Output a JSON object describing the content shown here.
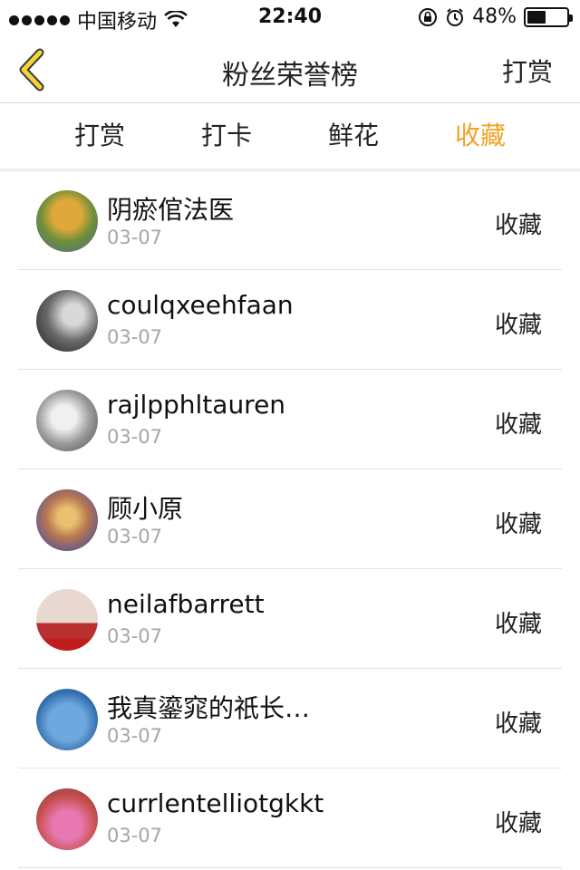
{
  "status_bar": {
    "carrier": "中国移动",
    "time": "22:40",
    "battery": "48%",
    "battery_level": 0.48,
    "icons": [
      "signal-dots-icon",
      "wifi-icon",
      "rotation-lock-icon",
      "alarm-icon",
      "battery-icon"
    ]
  },
  "nav": {
    "title": "粉丝荣誉榜",
    "action": "打赏",
    "back_icon": "chevron-left-icon",
    "accent_color": "#f0a224"
  },
  "tabs": [
    {
      "label": "打赏",
      "active": false
    },
    {
      "label": "打卡",
      "active": false
    },
    {
      "label": "鲜花",
      "active": false
    },
    {
      "label": "收藏",
      "active": true
    }
  ],
  "list": [
    {
      "name": "阴瘀倌法医",
      "date": "03-07",
      "tag": "收藏"
    },
    {
      "name": "coulqxeehfaan",
      "date": "03-07",
      "tag": "收藏"
    },
    {
      "name": "rajlpphltauren",
      "date": "03-07",
      "tag": "收藏"
    },
    {
      "name": "顾小原",
      "date": "03-07",
      "tag": "收藏"
    },
    {
      "name": "neilafbarrett",
      "date": "03-07",
      "tag": "收藏"
    },
    {
      "name": "我真鎏窕的祇长…",
      "date": "03-07",
      "tag": "收藏"
    },
    {
      "name": "currlentelliotgkkt",
      "date": "03-07",
      "tag": "收藏"
    }
  ]
}
